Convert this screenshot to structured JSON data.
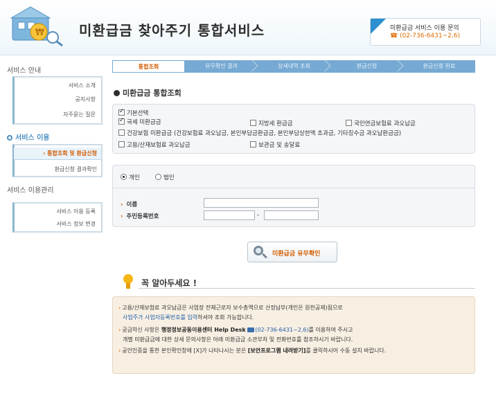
{
  "header": {
    "title": "미환급금 찾아주기 통합서비스",
    "contact_title": "미환급금 서비스 이용 문의",
    "contact_phone": "☎ (02-736-6431~2,6)"
  },
  "sidebar": {
    "sections": [
      {
        "title": "서비스 안내",
        "items": [
          "서비스 소개",
          "공지사항",
          "자주묻는 질문"
        ]
      },
      {
        "title": "서비스 이용",
        "items": [
          "› 통합조회 및 환급신청",
          "환급신청 결과확인"
        ]
      },
      {
        "title": "서비스 이용관리",
        "items": [
          "서비스 이용 등록",
          "서비스 정보 변경"
        ]
      }
    ]
  },
  "steps": [
    "통합조회",
    "유무확인 결과",
    "상세내역 조회",
    "환급신청",
    "환급신청 완료"
  ],
  "section_title": "미환급금 통합조회",
  "checkboxes": [
    {
      "label": "기본선택",
      "checked": true
    },
    {
      "label": "국세 미환급금",
      "checked": true
    },
    {
      "label": "지방세 환급금",
      "checked": false
    },
    {
      "label": "국민연금보험료 과오납금",
      "checked": false
    },
    {
      "label": "건강보험 미환급금 (건강보험료 과오납금, 본인부담금환급금, 본인부담상한액 초과금, 기타징수금 과오납환급금)",
      "checked": false
    },
    {
      "label": "고용/산재보험료 과오납금",
      "checked": false
    },
    {
      "label": "보관금 및 송달료",
      "checked": false
    }
  ],
  "radios": [
    {
      "label": "개인",
      "selected": true
    },
    {
      "label": "법인",
      "selected": false
    }
  ],
  "form": {
    "name_label": "이름",
    "name_value": "",
    "id_label": "주민등록번호",
    "id_front": "",
    "id_back": "",
    "dash": "-"
  },
  "search_button": "미환급금 유무확인",
  "notice": {
    "title": "꼭 알아두세요 !",
    "lines": [
      "고용/산재보험료 과오납금은 사업장 전체근로자 보수총액으로 산정납부(개인은 원천공제)됨으로",
      "사업주가 사업자등록번호를 입력",
      "하셔야 조회 가능합니다.",
      "궁금하신 사항은",
      "행정정보공동이용센터 Help Desk",
      "(02-736-6431~2,6)",
      "를 이용하여 주시고",
      "개별 미환급금에 대한 상세 문의사항은 아래 미환급금 소관부처 및 전화번호를 참조하시기 바랍니다.",
      "공인인증을 통한 본인확인창에 [X]가 나타나시는 분은",
      "[보안프로그램 내려받기]",
      "를 클릭하시어 수동 설치 바랍니다."
    ]
  },
  "colors": {
    "accent_orange": "#d15b00",
    "step_blue": "#76a9d3",
    "brand_blue": "#2c8fd0"
  }
}
